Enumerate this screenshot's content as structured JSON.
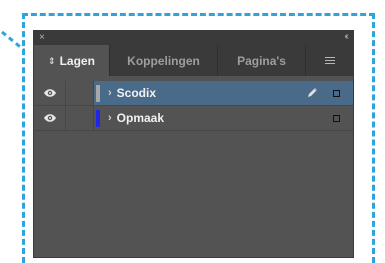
{
  "panel": {
    "close_glyph": "×",
    "collapse_glyph": "‹‹",
    "tabs": [
      {
        "label": "Lagen",
        "active": true
      },
      {
        "label": "Koppelingen",
        "active": false
      },
      {
        "label": "Pagina's",
        "active": false
      }
    ],
    "tab_sort_glyph": "⇕",
    "layers": [
      {
        "name": "Scodix",
        "color": "#a8a8a8",
        "visible": true,
        "selected": true,
        "editing": true
      },
      {
        "name": "Opmaak",
        "color": "#2027e6",
        "visible": true,
        "selected": false,
        "editing": false
      }
    ]
  },
  "colors": {
    "callout_border": "#2fa4dc",
    "selection": "#4a6a8a",
    "panel_bg": "#535353",
    "tabbar_bg": "#3a3a3a"
  }
}
